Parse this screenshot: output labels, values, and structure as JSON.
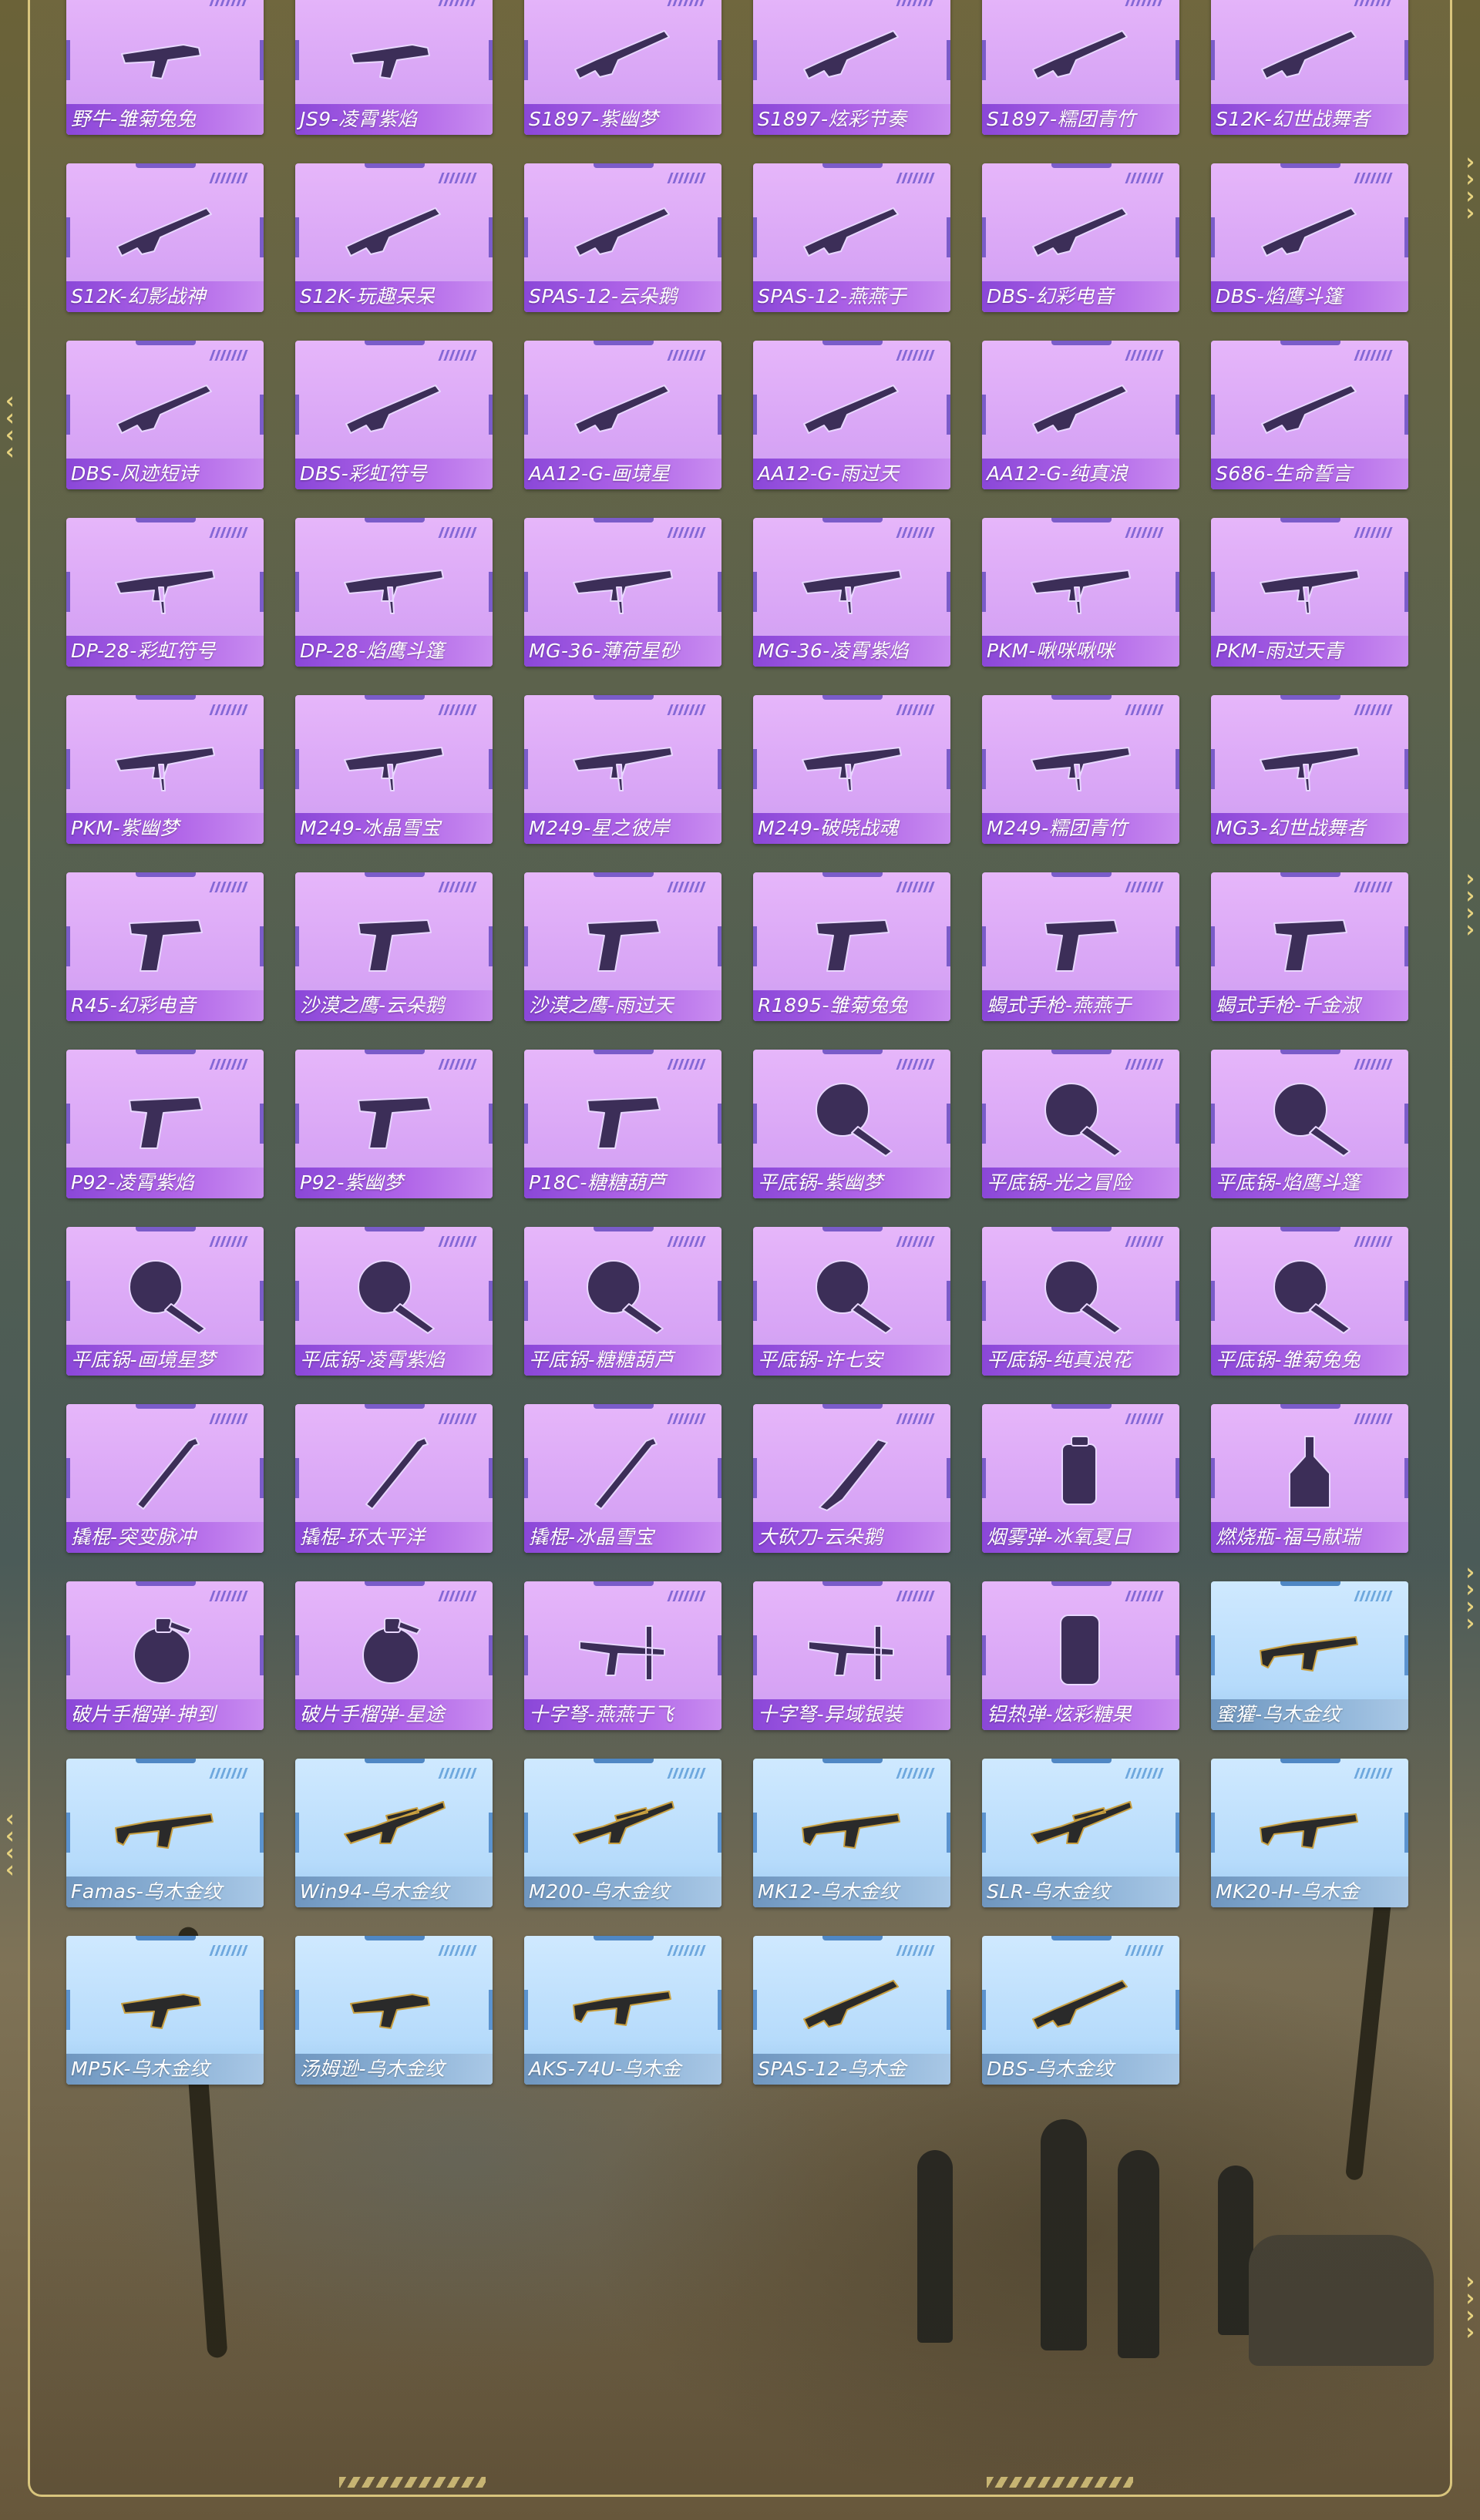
{
  "items": [
    {
      "name": "野牛-雏菊兔兔",
      "rarity": "purple",
      "icon": "smg-icon"
    },
    {
      "name": "JS9-凌霄紫焰",
      "rarity": "purple",
      "icon": "smg-icon"
    },
    {
      "name": "S1897-紫幽梦",
      "rarity": "purple",
      "icon": "shotgun-icon"
    },
    {
      "name": "S1897-炫彩节奏",
      "rarity": "purple",
      "icon": "shotgun-icon"
    },
    {
      "name": "S1897-糯团青竹",
      "rarity": "purple",
      "icon": "shotgun-icon"
    },
    {
      "name": "S12K-幻世战舞者",
      "rarity": "purple",
      "icon": "shotgun-icon"
    },
    {
      "name": "S12K-幻影战神",
      "rarity": "purple",
      "icon": "shotgun-icon"
    },
    {
      "name": "S12K-玩趣呆呆",
      "rarity": "purple",
      "icon": "shotgun-icon"
    },
    {
      "name": "SPAS-12-云朵鹅",
      "rarity": "purple",
      "icon": "shotgun-icon"
    },
    {
      "name": "SPAS-12-燕燕于",
      "rarity": "purple",
      "icon": "shotgun-icon"
    },
    {
      "name": "DBS-幻彩电音",
      "rarity": "purple",
      "icon": "shotgun-icon"
    },
    {
      "name": "DBS-焰鹰斗篷",
      "rarity": "purple",
      "icon": "shotgun-icon"
    },
    {
      "name": "DBS-风迹短诗",
      "rarity": "purple",
      "icon": "shotgun-icon"
    },
    {
      "name": "DBS-彩虹符号",
      "rarity": "purple",
      "icon": "shotgun-icon"
    },
    {
      "name": "AA12-G-画境星",
      "rarity": "purple",
      "icon": "shotgun-icon"
    },
    {
      "name": "AA12-G-雨过天",
      "rarity": "purple",
      "icon": "shotgun-icon"
    },
    {
      "name": "AA12-G-纯真浪",
      "rarity": "purple",
      "icon": "shotgun-icon"
    },
    {
      "name": "S686-生命誓言",
      "rarity": "purple",
      "icon": "shotgun-icon"
    },
    {
      "name": "DP-28-彩虹符号",
      "rarity": "purple",
      "icon": "lmg-icon"
    },
    {
      "name": "DP-28-焰鹰斗篷",
      "rarity": "purple",
      "icon": "lmg-icon"
    },
    {
      "name": "MG-36-薄荷星砂",
      "rarity": "purple",
      "icon": "lmg-icon"
    },
    {
      "name": "MG-36-凌霄紫焰",
      "rarity": "purple",
      "icon": "lmg-icon"
    },
    {
      "name": "PKM-啾咪啾咪",
      "rarity": "purple",
      "icon": "lmg-icon"
    },
    {
      "name": "PKM-雨过天青",
      "rarity": "purple",
      "icon": "lmg-icon"
    },
    {
      "name": "PKM-紫幽梦",
      "rarity": "purple",
      "icon": "lmg-icon"
    },
    {
      "name": "M249-冰晶雪宝",
      "rarity": "purple",
      "icon": "lmg-icon"
    },
    {
      "name": "M249-星之彼岸",
      "rarity": "purple",
      "icon": "lmg-icon"
    },
    {
      "name": "M249-破晓战魂",
      "rarity": "purple",
      "icon": "lmg-icon"
    },
    {
      "name": "M249-糯团青竹",
      "rarity": "purple",
      "icon": "lmg-icon"
    },
    {
      "name": "MG3-幻世战舞者",
      "rarity": "purple",
      "icon": "lmg-icon"
    },
    {
      "name": "R45-幻彩电音",
      "rarity": "purple",
      "icon": "pistol-icon"
    },
    {
      "name": "沙漠之鹰-云朵鹅",
      "rarity": "purple",
      "icon": "pistol-icon"
    },
    {
      "name": "沙漠之鹰-雨过天",
      "rarity": "purple",
      "icon": "pistol-icon"
    },
    {
      "name": "R1895-雏菊兔兔",
      "rarity": "purple",
      "icon": "pistol-icon"
    },
    {
      "name": "蝎式手枪-燕燕于",
      "rarity": "purple",
      "icon": "pistol-icon"
    },
    {
      "name": "蝎式手枪-千金淑",
      "rarity": "purple",
      "icon": "pistol-icon"
    },
    {
      "name": "P92-凌霄紫焰",
      "rarity": "purple",
      "icon": "pistol-icon"
    },
    {
      "name": "P92-紫幽梦",
      "rarity": "purple",
      "icon": "pistol-icon"
    },
    {
      "name": "P18C-糖糖葫芦",
      "rarity": "purple",
      "icon": "pistol-icon"
    },
    {
      "name": "平底锅-紫幽梦",
      "rarity": "purple",
      "icon": "pan-icon"
    },
    {
      "name": "平底锅-光之冒险",
      "rarity": "purple",
      "icon": "pan-icon"
    },
    {
      "name": "平底锅-焰鹰斗篷",
      "rarity": "purple",
      "icon": "pan-icon"
    },
    {
      "name": "平底锅-画境星梦",
      "rarity": "purple",
      "icon": "pan-icon"
    },
    {
      "name": "平底锅-凌霄紫焰",
      "rarity": "purple",
      "icon": "pan-icon"
    },
    {
      "name": "平底锅-糖糖葫芦",
      "rarity": "purple",
      "icon": "pan-icon"
    },
    {
      "name": "平底锅-许七安",
      "rarity": "purple",
      "icon": "pan-icon"
    },
    {
      "name": "平底锅-纯真浪花",
      "rarity": "purple",
      "icon": "pan-icon"
    },
    {
      "name": "平底锅-雏菊兔兔",
      "rarity": "purple",
      "icon": "pan-icon"
    },
    {
      "name": "撬棍-突变脉冲",
      "rarity": "purple",
      "icon": "crowbar-icon"
    },
    {
      "name": "撬棍-环太平洋",
      "rarity": "purple",
      "icon": "crowbar-icon"
    },
    {
      "name": "撬棍-冰晶雪宝",
      "rarity": "purple",
      "icon": "crowbar-icon"
    },
    {
      "name": "大砍刀-云朵鹅",
      "rarity": "purple",
      "icon": "machete-icon"
    },
    {
      "name": "烟雾弹-冰氧夏日",
      "rarity": "purple",
      "icon": "smoke-grenade-icon"
    },
    {
      "name": "燃烧瓶-福马献瑞",
      "rarity": "purple",
      "icon": "molotov-icon"
    },
    {
      "name": "破片手榴弹-抻到",
      "rarity": "purple",
      "icon": "grenade-icon"
    },
    {
      "name": "破片手榴弹-星途",
      "rarity": "purple",
      "icon": "grenade-icon"
    },
    {
      "name": "十字弩-燕燕于飞",
      "rarity": "purple",
      "icon": "crossbow-icon"
    },
    {
      "name": "十字弩-异域银装",
      "rarity": "purple",
      "icon": "crossbow-icon"
    },
    {
      "name": "铝热弹-炫彩糖果",
      "rarity": "purple",
      "icon": "thermite-icon"
    },
    {
      "name": "蜜獾-乌木金纹",
      "rarity": "blue",
      "icon": "rifle-icon"
    },
    {
      "name": "Famas-乌木金纹",
      "rarity": "blue",
      "icon": "rifle-icon"
    },
    {
      "name": "Win94-乌木金纹",
      "rarity": "blue",
      "icon": "sniper-icon"
    },
    {
      "name": "M200-乌木金纹",
      "rarity": "blue",
      "icon": "sniper-icon"
    },
    {
      "name": "MK12-乌木金纹",
      "rarity": "blue",
      "icon": "rifle-icon"
    },
    {
      "name": "SLR-乌木金纹",
      "rarity": "blue",
      "icon": "sniper-icon"
    },
    {
      "name": "MK20-H-乌木金",
      "rarity": "blue",
      "icon": "rifle-icon"
    },
    {
      "name": "MP5K-乌木金纹",
      "rarity": "blue",
      "icon": "smg-icon"
    },
    {
      "name": "汤姆逊-乌木金纹",
      "rarity": "blue",
      "icon": "smg-icon"
    },
    {
      "name": "AKS-74U-乌木金",
      "rarity": "blue",
      "icon": "rifle-icon"
    },
    {
      "name": "SPAS-12-乌木金",
      "rarity": "blue",
      "icon": "shotgun-icon"
    },
    {
      "name": "DBS-乌木金纹",
      "rarity": "blue",
      "icon": "shotgun-icon"
    }
  ],
  "colors": {
    "purple_card": "#dca8f7",
    "purple_label": "#9b52dd",
    "blue_card": "#bfe0fc",
    "blue_label": "#7fa6cd",
    "frame_gold": "#d9c57d"
  }
}
